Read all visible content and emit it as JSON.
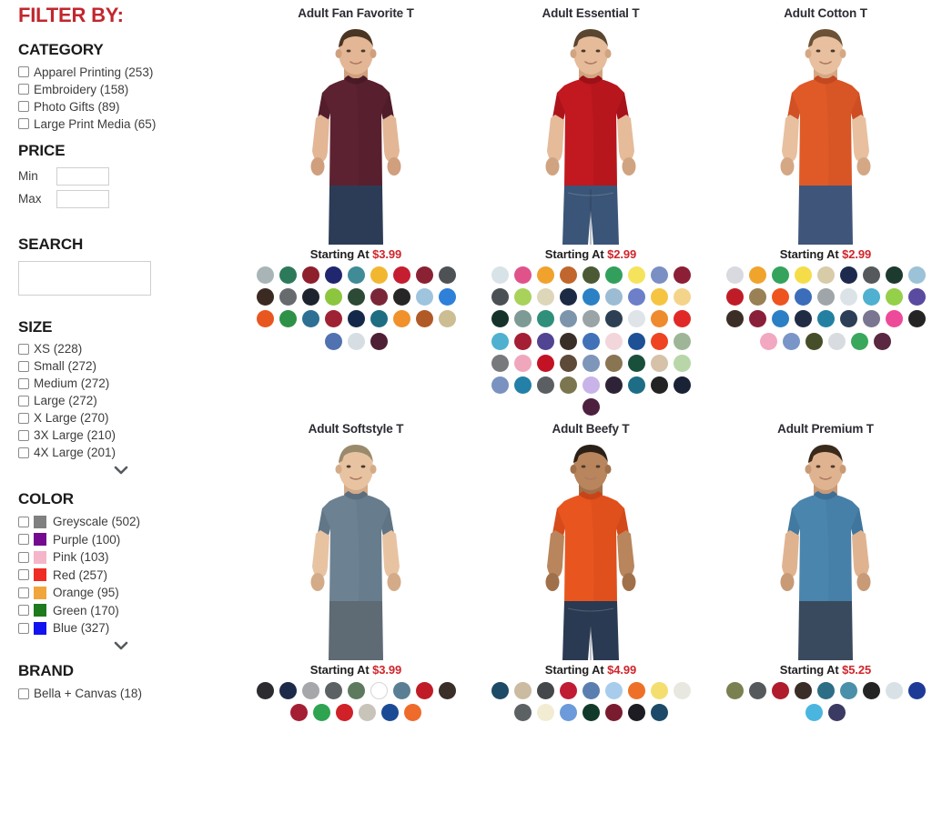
{
  "sidebar": {
    "heading": "FILTER BY:",
    "facets": [
      {
        "title": "CATEGORY",
        "type": "checkbox",
        "options": [
          {
            "label": "Apparel Printing (253)"
          },
          {
            "label": "Embroidery (158)"
          },
          {
            "label": "Photo Gifts (89)"
          },
          {
            "label": "Large Print Media (65)"
          }
        ]
      },
      {
        "title": "PRICE",
        "type": "price",
        "min_label": "Min",
        "max_label": "Max",
        "min_value": "",
        "max_value": ""
      },
      {
        "title": "SEARCH",
        "type": "search",
        "value": "",
        "placeholder": ""
      },
      {
        "title": "SIZE",
        "type": "checkbox",
        "has_expand": true,
        "expand_icon": "chevron-down-icon",
        "options": [
          {
            "label": "XS (228)"
          },
          {
            "label": "Small (272)"
          },
          {
            "label": "Medium (272)"
          },
          {
            "label": "Large (272)"
          },
          {
            "label": "X Large (270)"
          },
          {
            "label": "3X Large (210)"
          },
          {
            "label": "4X Large (201)"
          }
        ]
      },
      {
        "title": "COLOR",
        "type": "color",
        "has_expand": true,
        "expand_icon": "chevron-down-icon",
        "options": [
          {
            "label": "Greyscale (502)",
            "color": "#808080"
          },
          {
            "label": "Purple (100)",
            "color": "#730a8f"
          },
          {
            "label": "Pink (103)",
            "color": "#f4b6c8"
          },
          {
            "label": "Red (257)",
            "color": "#ee2b24"
          },
          {
            "label": "Orange (95)",
            "color": "#f0a63c"
          },
          {
            "label": "Green (170)",
            "color": "#1d7a1d"
          },
          {
            "label": "Blue (327)",
            "color": "#1313ef"
          }
        ]
      },
      {
        "title": "BRAND",
        "type": "checkbox",
        "options": [
          {
            "label": "Bella + Canvas (18)"
          }
        ]
      }
    ]
  },
  "products": [
    {
      "title": "Adult Fan Favorite T",
      "price_prefix": "Starting At ",
      "price": "$3.99",
      "shirt_color": "#5d2231",
      "shirt_shade": "#4a1a27",
      "pants_color": "#2c3c56",
      "hair_color": "#4a3524",
      "skin_color": "#e3b695",
      "skin_shade": "#cf9f7e",
      "swatches": [
        "#a9b4b6",
        "#2c7a5a",
        "#8e1f2d",
        "#20276e",
        "#3f8c97",
        "#f2b731",
        "#c41e30",
        "#8a2234",
        "#4e5255",
        "#3a2a22",
        "#676b6e",
        "#1d2430",
        "#8cc63f",
        "#2c4a36",
        "#7b2638",
        "#262626",
        "#9ec4de",
        "#2f80d8",
        "#e8571f",
        "#2e9148",
        "#2e6f94",
        "#9e2233",
        "#14294a",
        "#1d6d83",
        "#f0912c",
        "#b05a28",
        "#cdbd92",
        "#5172b0",
        "#d6dee4",
        "#4e1f35"
      ]
    },
    {
      "title": "Adult Essential T",
      "price_prefix": "Starting At ",
      "price": "$2.99",
      "shirt_color": "#c2181f",
      "shirt_shade": "#9c1118",
      "pants_color": "#3a5578",
      "hair_color": "#5a4530",
      "skin_color": "#e5bb9a",
      "skin_shade": "#d0a480",
      "swatches": [
        "#d8e3e8",
        "#e0538a",
        "#f0a22c",
        "#c1662c",
        "#4b5a34",
        "#32a05c",
        "#f5e35c",
        "#7a8fc4",
        "#8c1f35",
        "#4a5054",
        "#a8d25a",
        "#ddd6b8",
        "#1d2a44",
        "#2b81c4",
        "#9cbcd4",
        "#6c7fc8",
        "#f5c542",
        "#f4d48a",
        "#15332b",
        "#7e9a94",
        "#2f8f7a",
        "#7d95ab",
        "#9aa3a6",
        "#2d3f52",
        "#dfe4e9",
        "#ee8b2e",
        "#e02a28",
        "#4fb0cf",
        "#a41e34",
        "#514493",
        "#3a2f28",
        "#4172b8",
        "#f2d6dc",
        "#1e5096",
        "#ee4422",
        "#9fb598",
        "#77797c",
        "#f0a7bd",
        "#c41225",
        "#5e4a38",
        "#7d96ba",
        "#8a7553",
        "#18503c",
        "#d5c2a8",
        "#b8d6a8",
        "#7a92c0",
        "#2380a8",
        "#5b5f62",
        "#7c7650",
        "#c8b4e8",
        "#2e2336",
        "#1d6d86",
        "#232323",
        "#1a2236",
        "#4e2040"
      ]
    },
    {
      "title": "Adult Cotton T",
      "price_prefix": "Starting At ",
      "price": "$2.99",
      "shirt_color": "#e05a28",
      "shirt_shade": "#c44820",
      "pants_color": "#40557a",
      "hair_color": "#6b5236",
      "skin_color": "#e8c09f",
      "skin_shade": "#d4a885",
      "swatches": [
        "#d8dae0",
        "#f0a42c",
        "#35a35c",
        "#f5dd4a",
        "#d8cba8",
        "#1d2a4e",
        "#55595c",
        "#1d3a2e",
        "#9cc2d8",
        "#c01c28",
        "#9a8055",
        "#ee5420",
        "#3b6dba",
        "#9fa5a8",
        "#dce3e8",
        "#4fb0d0",
        "#95d04a",
        "#5a4aa0",
        "#3a2e26",
        "#8a1f3a",
        "#2b7fc4",
        "#1f2c44",
        "#2380a0",
        "#2d3f56",
        "#7a7590",
        "#ee4a9a",
        "#242424",
        "#f2a8c0",
        "#7a96c8",
        "#454e28",
        "#d8dce0",
        "#3aa85c",
        "#5a2840"
      ]
    },
    {
      "title": "Adult Softstyle T",
      "price_prefix": "Starting At ",
      "price": "$3.99",
      "shirt_color": "#6c8293",
      "shirt_shade": "#5a6e7e",
      "pants_color": "#5e6a74",
      "hair_color": "#9a8a6c",
      "skin_color": "#e8c3a2",
      "skin_shade": "#d4ab88",
      "swatches": [
        "#2b2b30",
        "#1d2a4a",
        "#a5a7aa",
        "#5c6164",
        "#5d7a5e",
        "#ffffff",
        "#5a7e94",
        "#c01c28",
        "#3a2e28",
        "#a41e34",
        "#2ea450",
        "#d02028",
        "#c8c4ba",
        "#1d4a94",
        "#ee6b2c"
      ]
    },
    {
      "title": "Adult Beefy T",
      "price_prefix": "Starting At ",
      "price": "$4.99",
      "shirt_color": "#e8551f",
      "shirt_shade": "#c84418",
      "pants_color": "#2a3a52",
      "hair_color": "#2a2018",
      "skin_color": "#b9855c",
      "skin_shade": "#a0704a",
      "swatches": [
        "#1d4a66",
        "#cbbba0",
        "#44484a",
        "#c01c34",
        "#5a7eb0",
        "#a8ccec",
        "#ee7028",
        "#f5de70",
        "#e8e8e0",
        "#5c6164",
        "#f2ecd2",
        "#6c9ada",
        "#123a2a",
        "#7a1c30",
        "#1c1c22",
        "#1d4a68"
      ]
    },
    {
      "title": "Adult Premium T",
      "price_prefix": "Starting At ",
      "price": "$5.25",
      "shirt_color": "#4a85ad",
      "shirt_shade": "#3d7096",
      "pants_color": "#3a4a5e",
      "hair_color": "#3a2a1c",
      "skin_color": "#e0b390",
      "skin_shade": "#c89a76",
      "swatches": [
        "#7a8050",
        "#55595c",
        "#b01c2c",
        "#3a2c26",
        "#2d6d86",
        "#4a90aa",
        "#242424",
        "#d8e2e6",
        "#1d3a96",
        "#4ab6e0",
        "#3a3a62"
      ]
    }
  ]
}
